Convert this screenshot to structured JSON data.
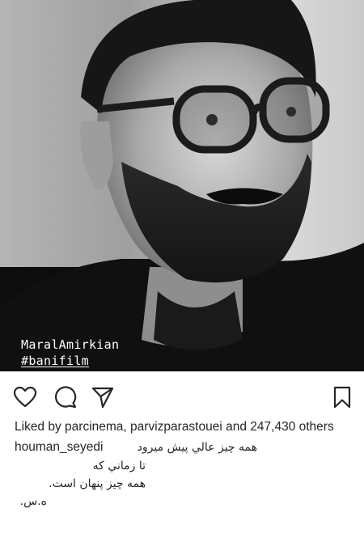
{
  "photo": {
    "watermark_line1": "MaralAmirkian",
    "watermark_line2": "#banifilm"
  },
  "actions": {
    "like_icon": "heart-icon",
    "comment_icon": "comment-icon",
    "share_icon": "paper-plane-icon",
    "save_icon": "bookmark-icon"
  },
  "likes": {
    "prefix": "Liked by",
    "user1": "parcinema,",
    "user2": "parvizparastouei",
    "conjunction": "and",
    "count": "247,430",
    "suffix": "others"
  },
  "caption": {
    "username": "houman_seyedi",
    "line1": "همه چيز عالي پيش ميرود",
    "line2": "تا زماني که",
    "line3": "همه چيز پنهان است.",
    "line4": "ه.س."
  },
  "colors": {
    "text": "#262626",
    "background": "#ffffff"
  }
}
